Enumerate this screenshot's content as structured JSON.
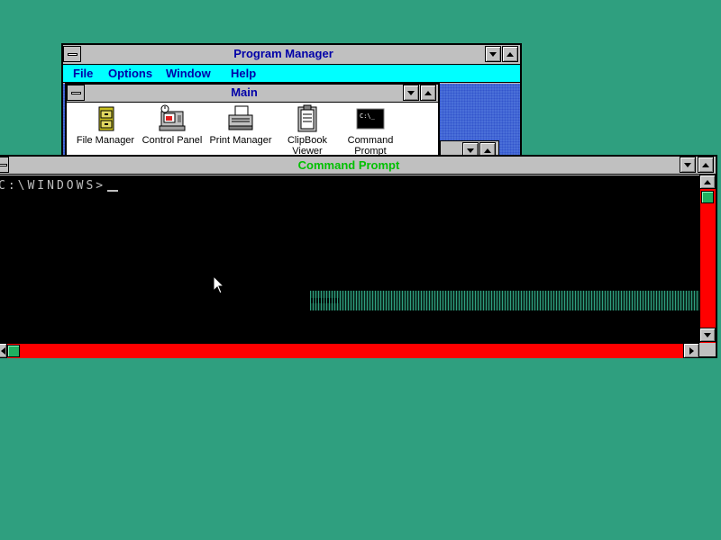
{
  "desktop": {
    "background": "#2f9f7f"
  },
  "program_manager": {
    "title": "Program Manager",
    "menu": [
      {
        "label": "File"
      },
      {
        "label": "Options"
      },
      {
        "label": "Window"
      },
      {
        "label": "Help"
      }
    ],
    "main_group": {
      "title": "Main",
      "icons": [
        {
          "label": "File Manager",
          "icon": "file-cabinet-icon"
        },
        {
          "label": "Control Panel",
          "icon": "control-panel-icon"
        },
        {
          "label": "Print Manager",
          "icon": "printer-icon"
        },
        {
          "label": "ClipBook Viewer",
          "icon": "clipbook-icon"
        },
        {
          "label": "Command Prompt",
          "icon": "command-prompt-icon"
        }
      ]
    }
  },
  "command_prompt": {
    "title": "Command Prompt",
    "title_color": "#00c000",
    "prompt_text": "C:\\WINDOWS>",
    "scrollbar_color": "#ff0000"
  }
}
